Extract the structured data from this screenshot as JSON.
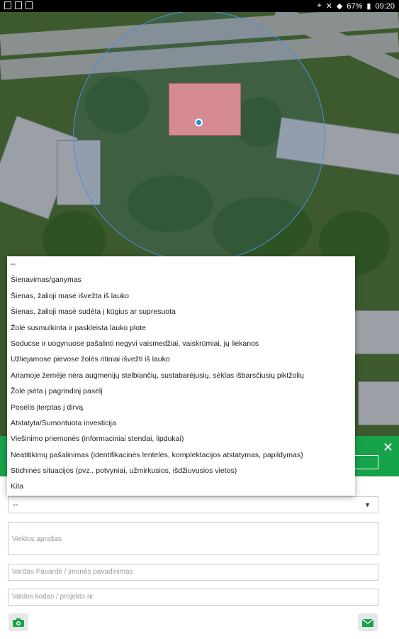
{
  "status_bar": {
    "battery": "67%",
    "time": "09:20"
  },
  "dropdown": {
    "options": [
      "--",
      "Šienavimas/ganymas",
      "Šienas, žalioji masė išvežta iš lauko",
      "Šienas, žalioji masė sudėta į kūgius ar supresuota",
      "Žolė susmulkinta ir paskleista lauko plote",
      "Soducse ir uogynuose pašalinti negyvi vaismedžiai, vaiskrūmiai, jų liekanos",
      "Užliejamose pievose žolės ritiniai išvežti iš lauko",
      "Ariamoje žemėje nėra augmenijų stelbiančių, sustabarėjusių, sėklas išbarsčiusių piktžolių",
      "Žolė įsėta į pagrindinį pasėlį",
      "Posėlis įterptas į dirvą",
      "Atstatyta/Sumontuota investicija",
      "Viešinimo priemonės (informaciniai stendai, lipdukai)",
      "Neatitikimų pašalinimas (identifikacinės lentelės, komplektacijos atstatymas, papildymas)",
      "Stichinės situacijos (pvz., potvyniai, užmirkusios, išdžiuvusios vietos)",
      "Kita"
    ]
  },
  "form": {
    "select_value": "--",
    "description_placeholder": "Veiklos aprašas",
    "name_placeholder": "Vardas Pavardė / įmonės pavadinimas",
    "code_placeholder": "Valdos kodas / projekto nr."
  },
  "colors": {
    "accent": "#17a34a",
    "location_dot": "#1e88e5"
  }
}
